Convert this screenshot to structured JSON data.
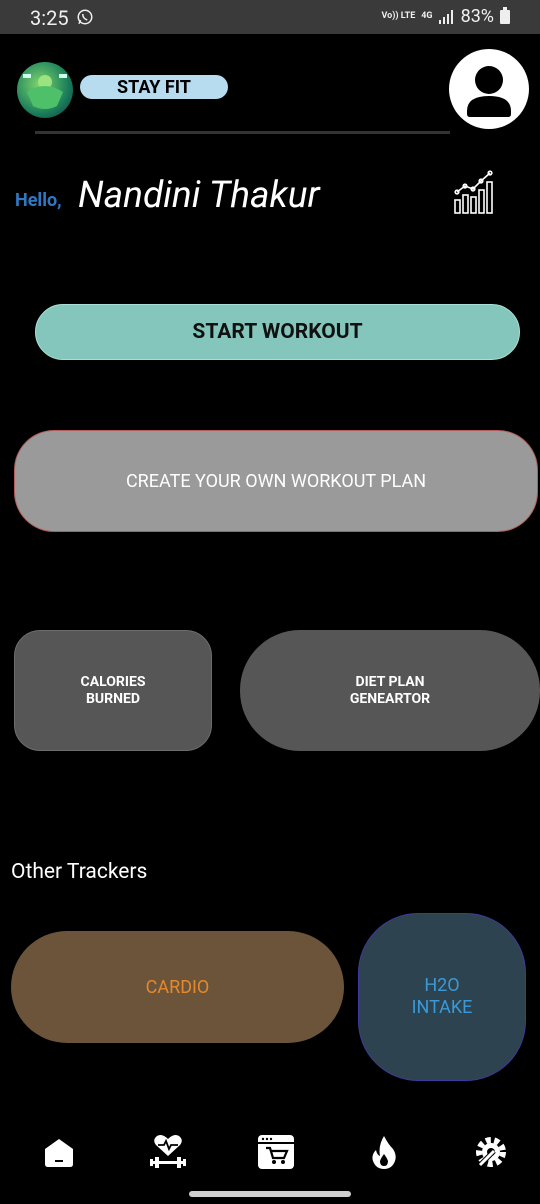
{
  "status_bar": {
    "time": "3:25",
    "volte": "Vo)) LTE",
    "network": "4G",
    "battery": "83%"
  },
  "header": {
    "app_name": "STAY FIT"
  },
  "greeting": {
    "hello": "Hello,",
    "name": "Nandini Thakur"
  },
  "buttons": {
    "start_workout": "START WORKOUT",
    "create_plan": "CREATE YOUR OWN WORKOUT PLAN",
    "calories": [
      "CALORIES",
      "BURNED"
    ],
    "diet_plan": [
      "DIET PLAN",
      "GENEARTOR"
    ]
  },
  "other_trackers": {
    "title": "Other Trackers",
    "cardio": "CARDIO",
    "h2o": [
      "H2O",
      "INTAKE"
    ]
  },
  "nav": {
    "items": [
      "home-icon",
      "heart-dumbbell-icon",
      "store-cart-icon",
      "fire-icon",
      "settings-gear-wrench-icon"
    ]
  },
  "colors": {
    "start_bg": "#84c6bc",
    "create_bg": "#9a9a9a",
    "card_bg": "#565656",
    "cardio_bg": "#6b5439",
    "cardio_text": "#e48a2c",
    "h2o_bg": "#2d4350",
    "h2o_text": "#3a99d6",
    "hello_text": "#2f78c4",
    "brand_pill": "#b7dcef"
  }
}
